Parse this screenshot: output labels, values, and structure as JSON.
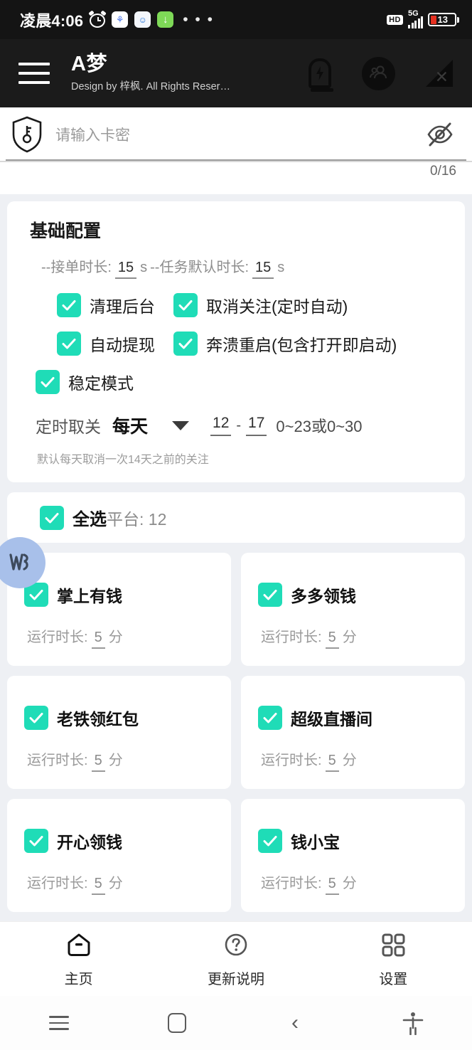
{
  "statusbar": {
    "time": "凌晨4:06",
    "icons": [
      "alarm-clock-icon",
      "cloud-app-icon",
      "doraemon-app-icon",
      "download-icon"
    ],
    "overflow": "• • •",
    "hd": "HD",
    "network": "5G",
    "battery_percent": "13"
  },
  "appbar": {
    "menu_label": "menu",
    "title": "A梦",
    "subtitle": "Design by 梓枫. All Rights Reser…",
    "icons": [
      "battery-boost-icon",
      "contacts-icon",
      "signal-off-icon"
    ]
  },
  "card_input": {
    "placeholder": "请输入卡密",
    "value": "",
    "counter": "0/16",
    "shield_icon": "shield-key-icon",
    "eye_icon": "eye-off-icon"
  },
  "basic_config": {
    "title": "基础配置",
    "duration_prefix": "--接单时长:",
    "duration_value": "15",
    "duration_unit": "s",
    "default_prefix": "--任务默认时长:",
    "default_value": "15",
    "default_unit": "s",
    "checkboxes": [
      {
        "label": "清理后台",
        "checked": true
      },
      {
        "label": "取消关注(定时自动)",
        "checked": true
      },
      {
        "label": "自动提现",
        "checked": true
      },
      {
        "label": "奔溃重启(包含打开即启动)",
        "checked": true
      },
      {
        "label": "稳定模式",
        "checked": true
      }
    ],
    "schedule": {
      "label": "定时取关",
      "selected": "每天",
      "start": "12",
      "separator": "-",
      "end": "17",
      "range_hint": "0~23或0~30",
      "note": "默认每天取消一次14天之前的关注"
    }
  },
  "platforms": {
    "select_all_bold": "全选",
    "select_all_gray": "平台: 12",
    "select_all_checked": true,
    "run_label": "运行时长:",
    "run_unit": "分",
    "items": [
      {
        "name": "掌上有钱",
        "checked": true,
        "duration": "5"
      },
      {
        "name": "多多领钱",
        "checked": true,
        "duration": "5"
      },
      {
        "name": "老铁领红包",
        "checked": true,
        "duration": "5"
      },
      {
        "name": "超级直播间",
        "checked": true,
        "duration": "5"
      },
      {
        "name": "开心领钱",
        "checked": true,
        "duration": "5"
      },
      {
        "name": "钱小宝",
        "checked": true,
        "duration": "5"
      }
    ]
  },
  "floating_widget": {
    "icon": "vhs-logo-icon"
  },
  "tabbar": {
    "items": [
      {
        "label": "主页",
        "icon": "home-icon",
        "active": true
      },
      {
        "label": "更新说明",
        "icon": "question-circle-icon",
        "active": false
      },
      {
        "label": "设置",
        "icon": "grid-squares-icon",
        "active": false
      }
    ]
  },
  "navbar": {
    "items": [
      "recents-icon",
      "home-square-icon",
      "back-chevron-icon",
      "accessibility-icon"
    ]
  },
  "colors": {
    "accent": "#1fdcb7",
    "header_bg": "#1b1b1b",
    "page_bg": "#eef0f4",
    "battery_red": "#e53121",
    "bubble": "#a8c0ea"
  }
}
